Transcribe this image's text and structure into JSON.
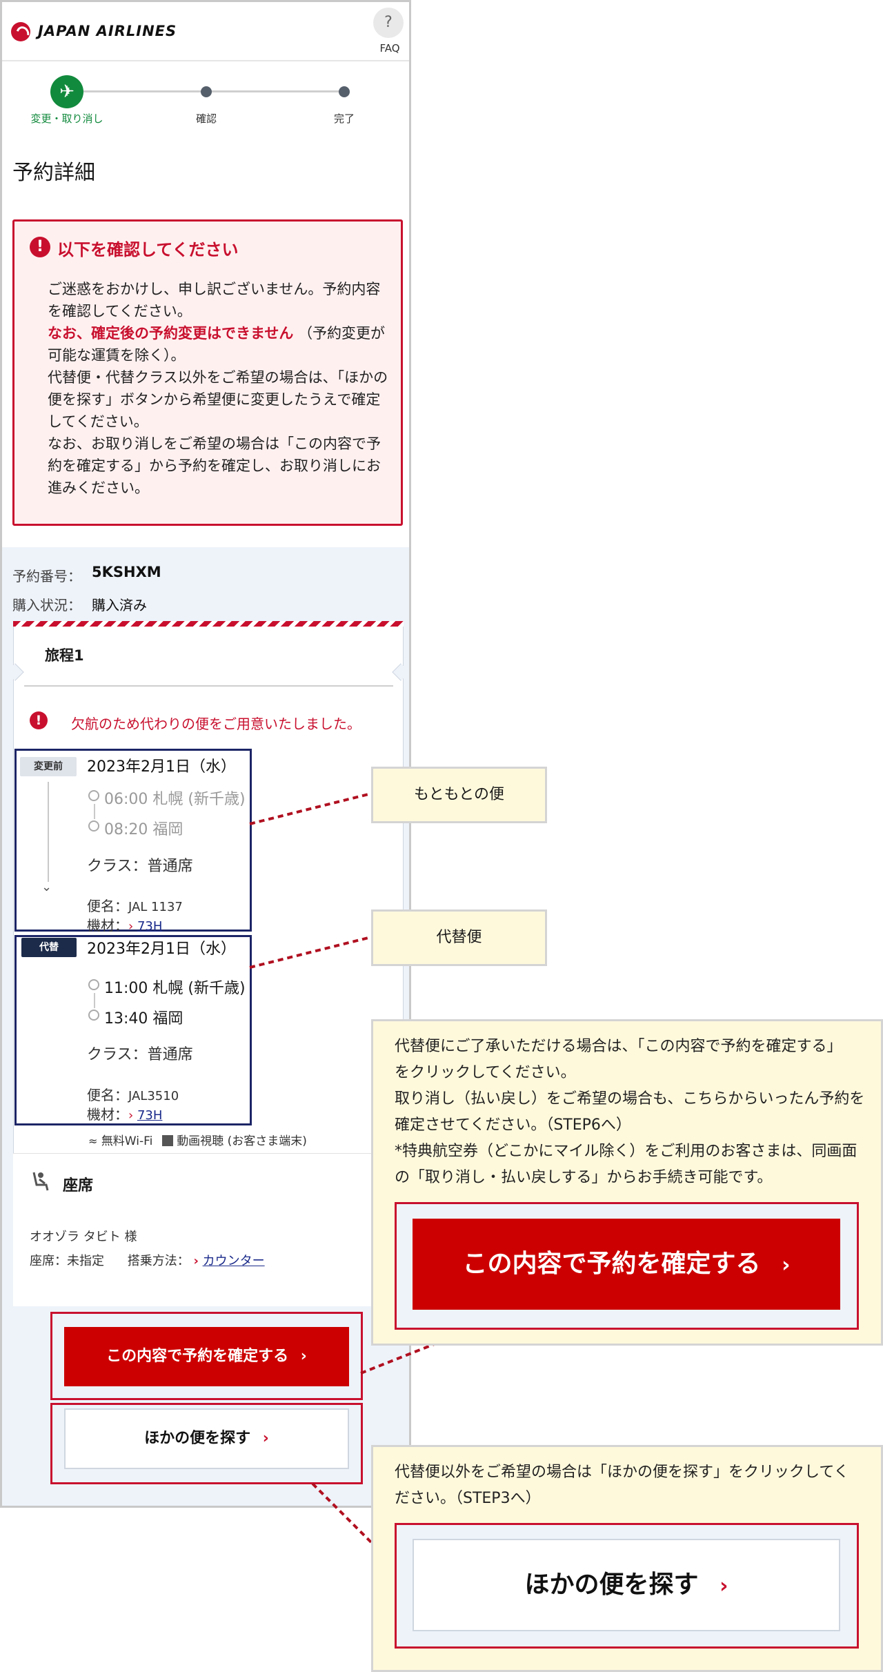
{
  "header": {
    "brand": "JAPAN AIRLINES",
    "faq_symbol": "?",
    "faq_label": "FAQ"
  },
  "steps": [
    {
      "label": "変更・取り消し"
    },
    {
      "label": "確認"
    },
    {
      "label": "完了"
    }
  ],
  "page_title": "予約詳細",
  "alert": {
    "title": "以下を確認してください",
    "icon_symbol": "!",
    "line1": "ご迷惑をおかけし、申し訳ございません。予約内容を確認してください。",
    "strong": "なお、確定後の予約変更はできません",
    "after_strong": "（予約変更が可能な運賃を除く）。",
    "line2": "代替便・代替クラス以外をご希望の場合は、「ほかの便を探す」ボタンから希望便に変更したうえで確定してください。",
    "line3": "なお、お取り消しをご希望の場合は「この内容で予約を確定する」から予約を確定し、お取り消しにお進みください。"
  },
  "reservation": {
    "number_label": "予約番号：",
    "number": "5KSHXM",
    "status_label": "購入状況：",
    "status": "購入済み"
  },
  "itinerary": {
    "title": "旅程1",
    "cancel_message": "欠航のため代わりの便をご用意いたしました。",
    "before": {
      "badge": "変更前",
      "date": "2023年2月1日（水）",
      "dep": "06:00 札幌 (新千歳)",
      "arr": "08:20 福岡",
      "class_label": "クラス：",
      "class": "普通席",
      "flight_label": "便名：",
      "flight": "JAL 1137",
      "equip_label": "機材：",
      "equip": "73H"
    },
    "alt": {
      "badge": "代替",
      "date": "2023年2月1日（水）",
      "dep": "11:00 札幌 (新千歳)",
      "arr": "13:40 福岡",
      "class_label": "クラス：",
      "class": "普通席",
      "flight_label": "便名：",
      "flight": "JAL3510",
      "equip_label": "機材：",
      "equip": "73H"
    },
    "amenities": {
      "wifi": "無料Wi-Fi",
      "video": "動画視聴 (お客さま端末)"
    }
  },
  "seat": {
    "title": "座席",
    "passenger": "オオゾラ タビト 様",
    "seat_label": "座席：",
    "seat": "未指定",
    "boarding_label": "搭乗方法：",
    "boarding": "カウンター"
  },
  "buttons": {
    "confirm": "この内容で予約を確定する",
    "search": "ほかの便を探す",
    "chevron": "›"
  },
  "callouts": {
    "original": "もともとの便",
    "alternate": "代替便",
    "confirm_lines": [
      "代替便にご了承いただける場合は、「この内容で予約を確定する」",
      "をクリックしてください。",
      "取り消し（払い戻し）をご希望の場合も、こちらからいったん予約を",
      "確定させてください。（STEP6へ）",
      "*特典航空券（どこかにマイル除く）をご利用のお客さまは、同画面",
      "の「取り消し・払い戻しする」からお手続き可能です。"
    ],
    "search_lines": [
      "代替便以外をご希望の場合は「ほかの便を探す」をクリックしてく",
      "ださい。（STEP3へ）"
    ]
  },
  "colors": {
    "brand_red": "#c8102e",
    "button_red": "#cc0000",
    "navy": "#1c2566",
    "step_green": "#128a3d",
    "callout_bg": "#fff9dc"
  }
}
